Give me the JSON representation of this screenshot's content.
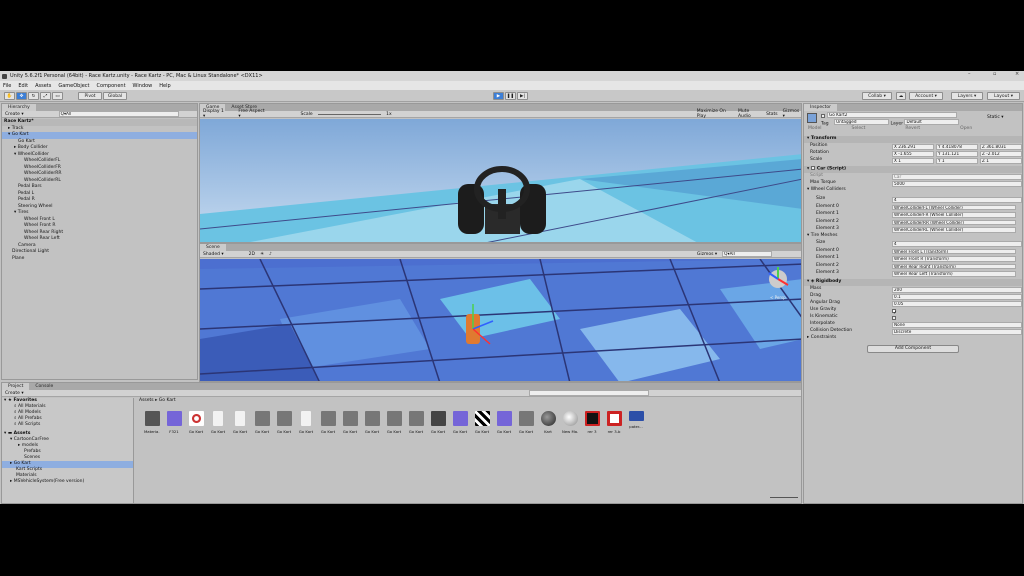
{
  "titlebar": {
    "text": "Unity 5.6.2f1 Personal (64bit) - Race Kartz.unity - Race Kartz - PC, Mac & Linux Standalone* <DX11>"
  },
  "menu": [
    "File",
    "Edit",
    "Assets",
    "GameObject",
    "Component",
    "Window",
    "Help"
  ],
  "toolbar": {
    "pivot": "Pivot",
    "global": "Global",
    "collab": "Collab ▾",
    "account": "Account ▾",
    "layers": "Layers ▾",
    "layout": "Layout ▾"
  },
  "hierarchy": {
    "tab": "Hierarchy",
    "create": "Create ▾",
    "search": "Q▾All",
    "scene": "Race Kartz*",
    "items": [
      "Track",
      "Go Kart",
      "Go Kart",
      "Body Collider",
      "WheelCollider",
      "WheelColliderFL",
      "WheelColliderFR",
      "WheelColliderRR",
      "WheelColliderRL",
      "Pedal Bars",
      "Pedal L",
      "Pedal R",
      "Steering Wheel",
      "Tires",
      "Wheel Front L",
      "Wheel Front R",
      "Wheel Rear Right",
      "Wheel Rear Left",
      "Camera",
      "Directional Light",
      "Plane"
    ]
  },
  "game": {
    "tab": "Game",
    "tab2": "Asset Store",
    "display": "Display 1 ▾",
    "aspect": "Free Aspect ▾",
    "scale_label": "Scale",
    "scale_value": "1x",
    "maximize": "Maximize On Play",
    "mute": "Mute Audio",
    "stats": "Stats",
    "gizmos": "Gizmos ▾"
  },
  "scene": {
    "tab": "Scene",
    "shaded": "Shaded ▾",
    "mode2d": "2D",
    "gizmos": "Gizmos ▾",
    "search": "Q▾All",
    "persp": "< Persp"
  },
  "inspector": {
    "tab": "Inspector",
    "name": "Go Kart2",
    "static": "Static ▾",
    "tag_label": "Tag",
    "tag": "Untagged",
    "layer_label": "Layer",
    "layer": "Default",
    "model": "Model",
    "select": "Select",
    "revert": "Revert",
    "open": "Open",
    "transform": {
      "title": "Transform",
      "position": "Position",
      "rotation": "Rotation",
      "scale": "Scale",
      "px": "X 236.291",
      "py": "Y 4.418078",
      "pz": "Z 361.8031",
      "rx": "X -1.655",
      "ry": "Y 131.121",
      "rz": "Z -2.012",
      "sx": "X 1",
      "sy": "Y 1",
      "sz": "Z 1"
    },
    "car": {
      "title": "Car (Script)",
      "script": "Script",
      "script_val": "Car",
      "torque": "Max Torque",
      "torque_val": "5000",
      "wc": "Wheel Colliders",
      "size": "Size",
      "size_val": "4",
      "e0": "Element 0",
      "e1": "Element 1",
      "e2": "Element 2",
      "e3": "Element 3",
      "wc0": "WheelColliderFL (Wheel Collider)",
      "wc1": "WheelColliderFR (Wheel Collider)",
      "wc2": "WheelColliderRR (Wheel Collider)",
      "wc3": "WheelColliderRL (Wheel Collider)",
      "tm": "Tire Meshes",
      "tm0": "Wheel Front L (Transform)",
      "tm1": "Wheel Front R (Transform)",
      "tm2": "Wheel Rear Right (Transform)",
      "tm3": "Wheel Rear Left (Transform)"
    },
    "rb": {
      "title": "Rigidbody",
      "mass": "Mass",
      "mass_val": "200",
      "drag": "Drag",
      "drag_val": "0.1",
      "adrag": "Angular Drag",
      "adrag_val": "0.05",
      "grav": "Use Gravity",
      "kin": "Is Kinematic",
      "interp": "Interpolate",
      "interp_val": "None",
      "coll": "Collision Detection",
      "coll_val": "Discrete",
      "cons": "Constraints"
    },
    "add": "Add Component"
  },
  "project": {
    "tab": "Project",
    "tab2": "Console",
    "create": "Create ▾",
    "path1": "Assets",
    "path2": "Go Kart",
    "fav": "Favorites",
    "favs": [
      "All Materials",
      "All Models",
      "All Prefabs",
      "All Scripts"
    ],
    "assets": "Assets",
    "tree": [
      "CartoonCarFree",
      "models",
      "Prefabs",
      "Scenes",
      "Go Kart",
      "Kart Scripts",
      "Materials",
      "MSVehicleSystem(Free version)"
    ],
    "items": [
      "Materia...",
      "F321",
      "Go Kart",
      "Go Kart",
      "Go Kart",
      "Go Kart",
      "Go Kart",
      "Go Kart",
      "Go Kart",
      "Go Kart",
      "Go Kart",
      "Go Kart",
      "Go Kart",
      "Go Kart",
      "Go Kart",
      "Go Kart",
      "Go Kart",
      "Go Kart",
      "Kart",
      "New Ma...",
      "rer 3",
      "rer 3-b",
      "pater..."
    ]
  }
}
